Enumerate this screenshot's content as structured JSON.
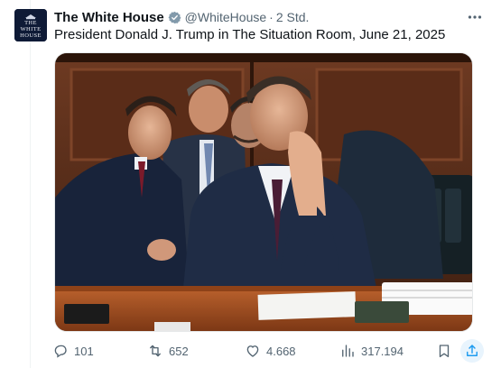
{
  "account": {
    "display_name": "The White House",
    "handle": "@WhiteHouse",
    "separator": "·",
    "time": "2 Std.",
    "logo_text": [
      "THE",
      "WHITE",
      "HOUSE"
    ]
  },
  "tweet": {
    "text": "President Donald J. Trump in The Situation Room, June 21, 2025"
  },
  "media": {
    "description_icon": "photo"
  },
  "actions": {
    "reply_count": "101",
    "retweet_count": "652",
    "like_count": "4.668",
    "views_count": "317.194"
  },
  "colors": {
    "muted": "#536471",
    "verified_badge": "#829aab",
    "share_highlight": "#1d9bf0"
  },
  "icons": {
    "more": "more-dots-icon",
    "reply": "reply-bubble-icon",
    "retweet": "retweet-arrows-icon",
    "like": "heart-icon",
    "views": "bar-chart-icon",
    "bookmark": "bookmark-icon",
    "share": "share-upload-icon",
    "badge": "verified-badge-icon"
  }
}
